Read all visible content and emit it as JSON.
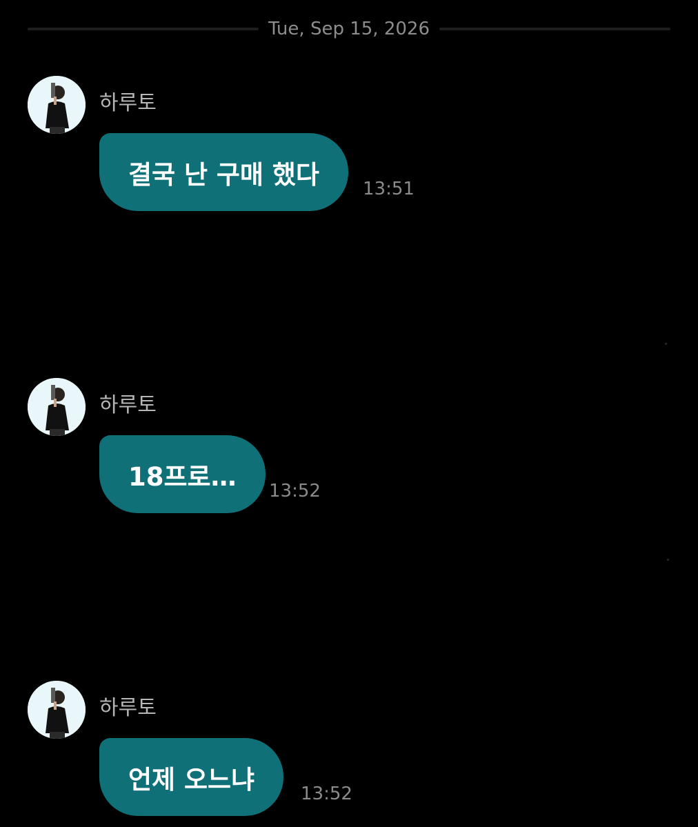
{
  "chat": {
    "date_divider": "Tue, Sep 15, 2026",
    "messages": [
      {
        "sender": "하루토",
        "text": "결국 난 구매 했다",
        "time": "13:51"
      },
      {
        "sender": "하루토",
        "text": "18프로…",
        "time": "13:52"
      },
      {
        "sender": "하루토",
        "text": "언제 오느냐",
        "time": "13:52"
      }
    ]
  },
  "colors": {
    "background": "#000000",
    "bubble": "#0f7078",
    "bubble_text": "#ffffff",
    "sender_name": "#b7b7b7",
    "timestamp": "#8b8b8b",
    "avatar_bg": "#e9f7fa"
  },
  "icons": {
    "avatar": "profile-photo-person-in-black-shirt"
  }
}
